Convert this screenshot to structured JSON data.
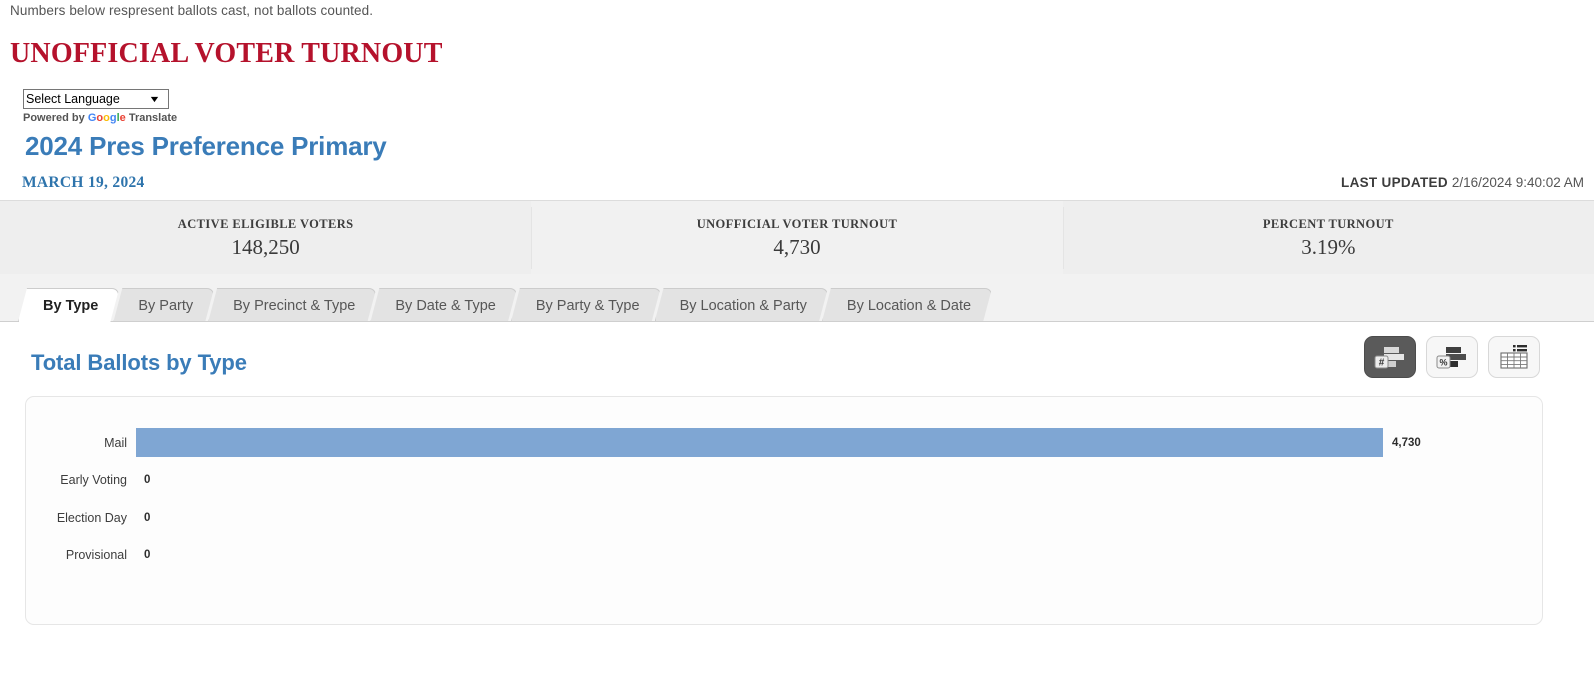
{
  "top_note": "Numbers below respresent ballots cast, not ballots counted.",
  "headline": "UNOFFICIAL VOTER TURNOUT",
  "translate": {
    "selected": "Select Language",
    "caret_icon": "chevron-down-icon",
    "powered_by": "Powered by",
    "brand_g": "G",
    "brand_o1": "o",
    "brand_o2": "o",
    "brand_g2": "g",
    "brand_l": "l",
    "brand_e": "e",
    "translate_word": "Translate"
  },
  "election": {
    "title": "2024 Pres Preference Primary",
    "date": "MARCH 19, 2024",
    "last_updated_label": "LAST UPDATED",
    "last_updated_value": "2/16/2024 9:40:02 AM"
  },
  "stats": [
    {
      "label": "ACTIVE ELIGIBLE VOTERS",
      "value": "148,250"
    },
    {
      "label": "UNOFFICIAL VOTER TURNOUT",
      "value": "4,730"
    },
    {
      "label": "PERCENT TURNOUT",
      "value": "3.19%"
    }
  ],
  "tabs": [
    {
      "label": "By Type",
      "active": true
    },
    {
      "label": "By Party",
      "active": false
    },
    {
      "label": "By Precinct & Type",
      "active": false
    },
    {
      "label": "By Date & Type",
      "active": false
    },
    {
      "label": "By Party & Type",
      "active": false
    },
    {
      "label": "By Location & Party",
      "active": false
    },
    {
      "label": "By Location & Date",
      "active": false
    }
  ],
  "chart_header": {
    "title": "Total Ballots by Type",
    "buttons": [
      {
        "name": "count-chart-button",
        "icon": "bar-chart-number-icon",
        "glyph": "#",
        "active": true
      },
      {
        "name": "percent-chart-button",
        "icon": "bar-chart-percent-icon",
        "glyph": "%",
        "active": false
      },
      {
        "name": "table-view-button",
        "icon": "table-grid-icon",
        "glyph": "",
        "active": false
      }
    ]
  },
  "chart_data": {
    "type": "bar",
    "orientation": "horizontal",
    "title": "Total Ballots by Type",
    "xlabel": "",
    "ylabel": "",
    "categories": [
      "Mail",
      "Early Voting",
      "Election Day",
      "Provisional"
    ],
    "values": [
      4730,
      0,
      0,
      0
    ],
    "value_labels": [
      "4,730",
      "0",
      "0",
      "0"
    ],
    "xlim": [
      0,
      4730
    ],
    "grid": false,
    "legend": false,
    "bar_color": "#7fa6d3"
  },
  "colors": {
    "headline_red": "#b5122c",
    "title_blue": "#3a7cb8",
    "bar_blue": "#7fa6d3",
    "strip_gray": "#eeeeee"
  }
}
